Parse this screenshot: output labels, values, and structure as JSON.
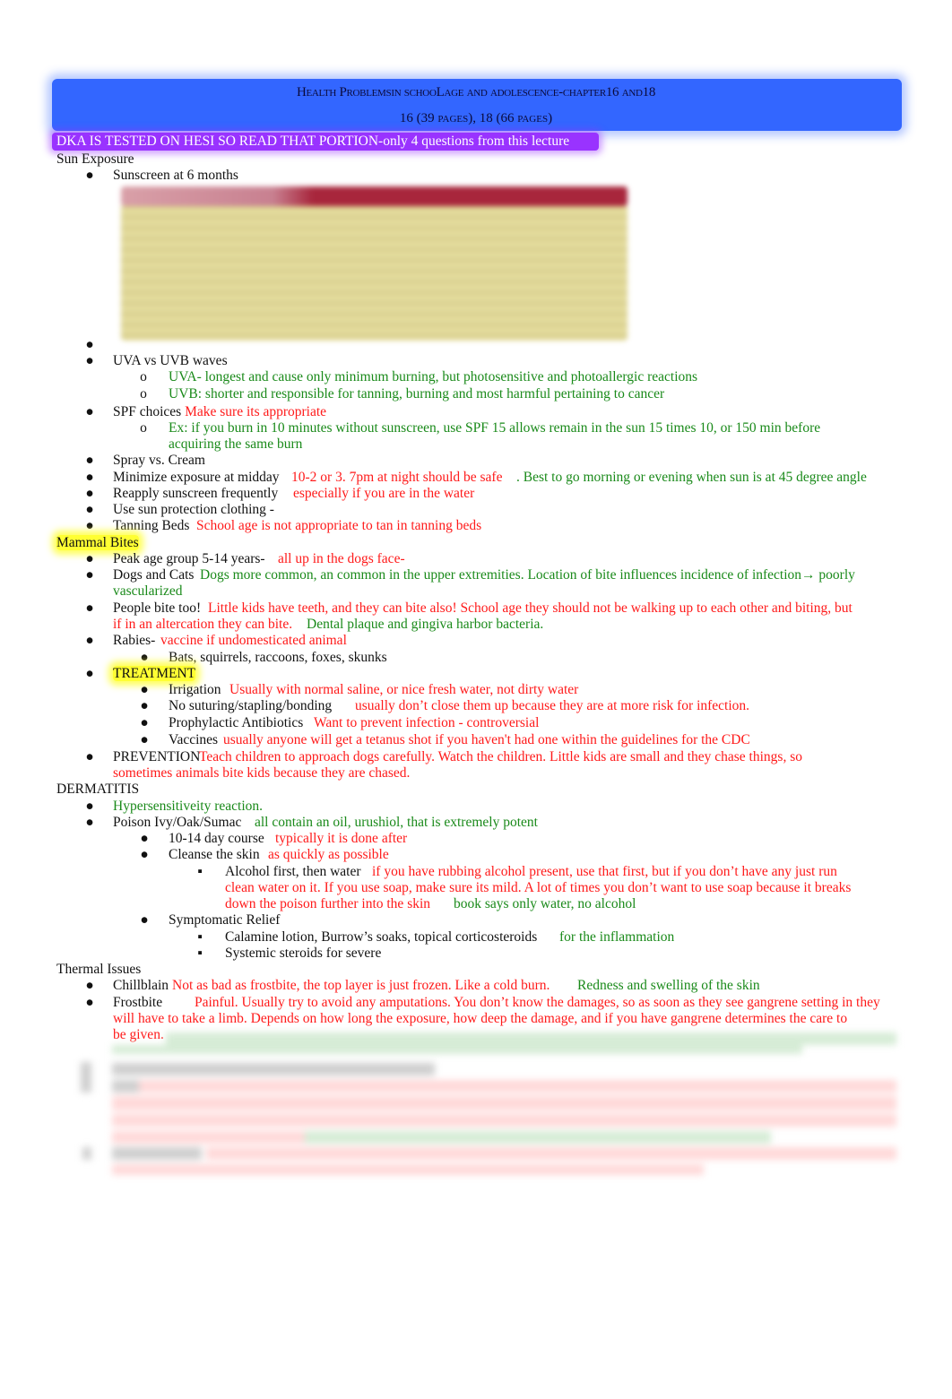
{
  "header": {
    "title": "Health Problemsin schooLage and adolescence-chapter16  and18",
    "subtitle": "16 (39  pages), 18 (66  pages)",
    "band_color": "#3366ff"
  },
  "notice": {
    "text": "DKA IS TESTED ON HESI SO READ THAT PORTION-only 4 questions from this lecture",
    "band_color": "#9933ff"
  },
  "colors": {
    "red_note": "#ff1a1a",
    "green_note": "#1a8a1a",
    "highlight": "#ffff33"
  },
  "sun_exposure": {
    "heading": "Sun Exposure",
    "sunscreen": "Sunscreen at 6 months",
    "embedded_image": "blurred-table-image",
    "uva_uvb": {
      "label": "UVA vs UVB waves",
      "uva": "UVA- longest and cause only minimum burning, but photosensitive and photoallergic reactions",
      "uvb": "UVB: shorter and responsible for tanning, burning and most harmful pertaining to cancer"
    },
    "spf": {
      "label": "SPF choices",
      "note": "Make sure its appropriate",
      "example_line1": "Ex: if you burn in 10 minutes without sunscreen, use SPF 15 allows remain in the sun 15 times 10, or 150 min before",
      "example_line2": "acquiring the same burn"
    },
    "spray": "Spray vs. Cream",
    "midday": {
      "label": "Minimize exposure at midday",
      "red": "10-2 or 3. 7pm at night should be safe",
      "green": ". Best to go morning or evening when sun is at 45 degree angle"
    },
    "reapply": {
      "label": "Reapply sunscreen frequently",
      "red": "especially if you are in the water"
    },
    "clothing": "Use sun protection clothing -",
    "tanning": {
      "label": "Tanning Beds",
      "red": "School age is not appropriate to tan in tanning beds"
    }
  },
  "mammal_bites": {
    "heading": "Mammal Bites",
    "peak": {
      "label": "Peak age group 5-14 years-",
      "red": "all up in the dogs face-"
    },
    "dogs_cats": {
      "label": "Dogs and Cats",
      "green1": "Dogs more common, an common in the upper extremities. Location of bite influences incidence of infection→ poorly",
      "green2": "vascularized"
    },
    "people": {
      "label": "People bite too!",
      "red1": "Little kids have teeth, and they can bite also! School age they should not be walking up to each other and biting, but",
      "red2": "if in an altercation they can bite.",
      "green": "Dental plaque and gingiva harbor bacteria."
    },
    "rabies": {
      "label": "Rabies-",
      "red": "vaccine if undomesticated animal",
      "sub": "Bats, squirrels, raccoons, foxes, skunks"
    },
    "treatment": {
      "label": "TREATMENT",
      "items": [
        {
          "label": "Irrigation",
          "red": "Usually with normal saline, or nice fresh water, not dirty water"
        },
        {
          "label": "No suturing/stapling/bonding",
          "red": "usually don’t close them up because they are at more risk for infection."
        },
        {
          "label": "Prophylactic Antibiotics",
          "red": "Want to prevent infection    - controversial"
        },
        {
          "label": "Vaccines",
          "red": "usually anyone will get a tetanus shot if you haven't had one within the guidelines for the CDC"
        }
      ]
    },
    "prevention": {
      "label": "PREVENTION",
      "red1": "Teach children to approach dogs carefully. Watch the children. Little kids are small and they chase things, so",
      "red2": "sometimes animals bite kids because they are chased."
    }
  },
  "dermatitis": {
    "heading": "DERMATITIS",
    "hyper": "Hypersensitiveity reaction.",
    "poison": {
      "label": "Poison Ivy/Oak/Sumac",
      "green": "all contain an oil, urushiol, that is extremely potent"
    },
    "course": {
      "label": "10-14 day course",
      "red": "typically it is done after"
    },
    "cleanse": {
      "label": "Cleanse the skin",
      "red": "as quickly as possible"
    },
    "alcohol": {
      "label": "Alcohol first, then water",
      "red1": "if you have rubbing alcohol present, use that first, but if you don’t have any just run",
      "red2": "clean water on it. If you use soap, make sure its mild. A lot of times you don’t want to use soap because it breaks",
      "red3": "down the poison further into the skin",
      "green": "book says only water, no alcohol"
    },
    "symptomatic": {
      "label": "Symptomatic Relief",
      "calamine": {
        "label": "Calamine lotion, Burrow’s soaks, topical corticosteroids",
        "green": "for the inflammation"
      },
      "systemic": "Systemic steroids for severe"
    }
  },
  "thermal": {
    "heading": "Thermal Issues",
    "chillblain": {
      "label": "Chillblain",
      "red": "Not as bad as frostbite, the top layer is just frozen. Like a cold burn.",
      "green": "Redness and swelling of the skin"
    },
    "frostbite": {
      "label": "Frostbite",
      "red1": "Painful. Usually try to avoid any amputations. You don’t know the damages, so as soon as they see gangrene setting in they",
      "red2": "will have to take a limb. Depends on how long the exposure, how deep the damage, and if you have gangrene determines the care to",
      "red3": "be given."
    }
  },
  "bullets": {
    "disc": "●",
    "circle": "o",
    "square": "▪"
  }
}
